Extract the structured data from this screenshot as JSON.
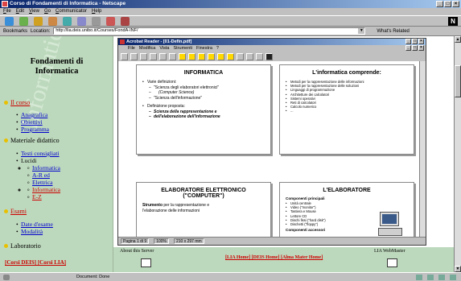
{
  "window": {
    "title": "Corso di Fondamenti di Informatica - Netscape"
  },
  "menu": [
    "File",
    "Edit",
    "View",
    "Go",
    "Communicator",
    "Help"
  ],
  "location": {
    "bookmarks": "Bookmarks",
    "label": "Location:",
    "url": "http://lia.deis.unibo.it/Courses/FondA-INF/",
    "related": "What's Related"
  },
  "sidebar": {
    "title_1": "Fondamenti di",
    "title_2": "Informatica",
    "sec_corso": "Il corso",
    "corso_items": [
      "Anagrafica",
      "Obiettivi",
      "Programma"
    ],
    "sec_materiale": "Materiale didattico",
    "materiale_items": [
      "Testi consigliati",
      "Lucidi"
    ],
    "lucidi_sub": [
      "Informatica",
      "A-R ed",
      "Elettrica",
      "Informatica",
      "E-Z"
    ],
    "sec_esami": "Esami",
    "esami_items": [
      "Date d'esame",
      "Modalità"
    ],
    "sec_lab": "Laboratorio",
    "footer": "[Corsi DEIS] [Corsi LIA]"
  },
  "acrobat": {
    "title": "Acrobat Reader - [01-Defin.pdf]",
    "menu": [
      "File",
      "Modifica",
      "Vista",
      "Strumenti",
      "Finestra",
      "?"
    ],
    "status": {
      "page": "Pagina 1 di 9",
      "zoom": "100%",
      "size": "210 x 297 mm"
    }
  },
  "slides": {
    "s1": {
      "title": "INFORMATICA",
      "b1": "Varie definizioni:",
      "b1a": "\"Scienza degli elaboratori elettronici\"",
      "b1a2": "(Computer Science)",
      "b1b": "\"Scienza dell'informazione\"",
      "b2": "Definizione proposta:",
      "b2a": "Scienza della rappresentazione e",
      "b2a2": "dell'elaborazione dell'informazione"
    },
    "s2": {
      "title": "L'informatica comprende:",
      "items": [
        "Metodi per la rappresentazione delle informazioni",
        "Metodi per la rappresentazione delle soluzioni",
        "Linguaggi di programmazione",
        "Architetture dei calcolatori",
        "Sistemi operativi",
        "Reti di calcolatori",
        "Calcolo numerico",
        "..."
      ]
    },
    "s3": {
      "title": "ELABORATORE ELETTRONICO",
      "subtitle": "(\"COMPUTER\")",
      "text_bold": "Strumento",
      "text_1": "per la rappresentazione e",
      "text_2": "l'elaborazione delle informazioni"
    },
    "s4": {
      "title": "L'ELABORATORE",
      "head": "Componenti principali",
      "items": [
        "Unità centrale",
        "Video (\"monitor\")",
        "Tastiera e Mouse",
        "Lettore CD",
        "Dischi fissi (\"hard disk\")",
        "Dischetti (\"floppy\")"
      ],
      "foot": "Componenti accessori"
    }
  },
  "bottom": {
    "about": "About this Server",
    "links": "[LIA Home] [DEIS Home] [Alma Mater Home]",
    "webmaster": "LIA WebMaster"
  },
  "status": {
    "text": "Document: Done"
  }
}
